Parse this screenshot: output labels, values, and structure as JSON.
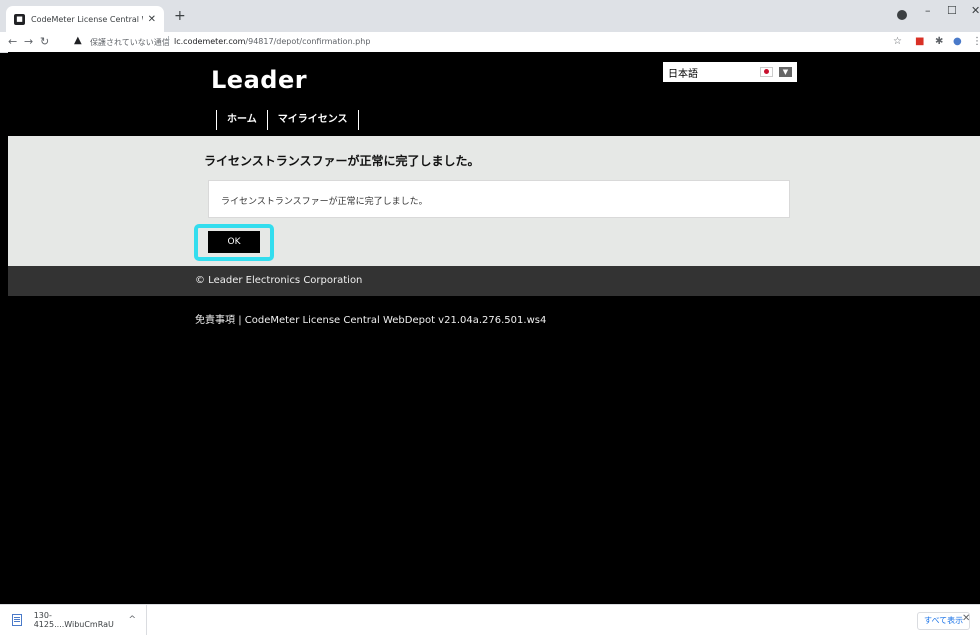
{
  "browser": {
    "tab_title": "CodeMeter License Central WebD",
    "favicon_icon": "codemeter-favicon",
    "new_tab": "+",
    "security_label": "保護されていない通信",
    "url_host": "lc.codemeter.com",
    "url_path": "/94817/depot/confirmation.php"
  },
  "header": {
    "logo": "Leader",
    "language": "日本語",
    "nav": [
      "ホーム",
      "マイライセンス"
    ]
  },
  "main": {
    "heading": "ライセンストランスファーが正常に完了しました。",
    "message": "ライセンストランスファーが正常に完了しました。",
    "ok_label": "OK",
    "highlight_color": "#33ddee"
  },
  "footer": {
    "copyright": "© Leader Electronics Corporation",
    "disclaimer": "免責事項",
    "separator": "|",
    "version": "CodeMeter License Central WebDepot v21.04a.276.501.ws4"
  },
  "downloads": {
    "file_name": "130-4125....WibuCmRaU",
    "show_all": "すべて表示"
  }
}
